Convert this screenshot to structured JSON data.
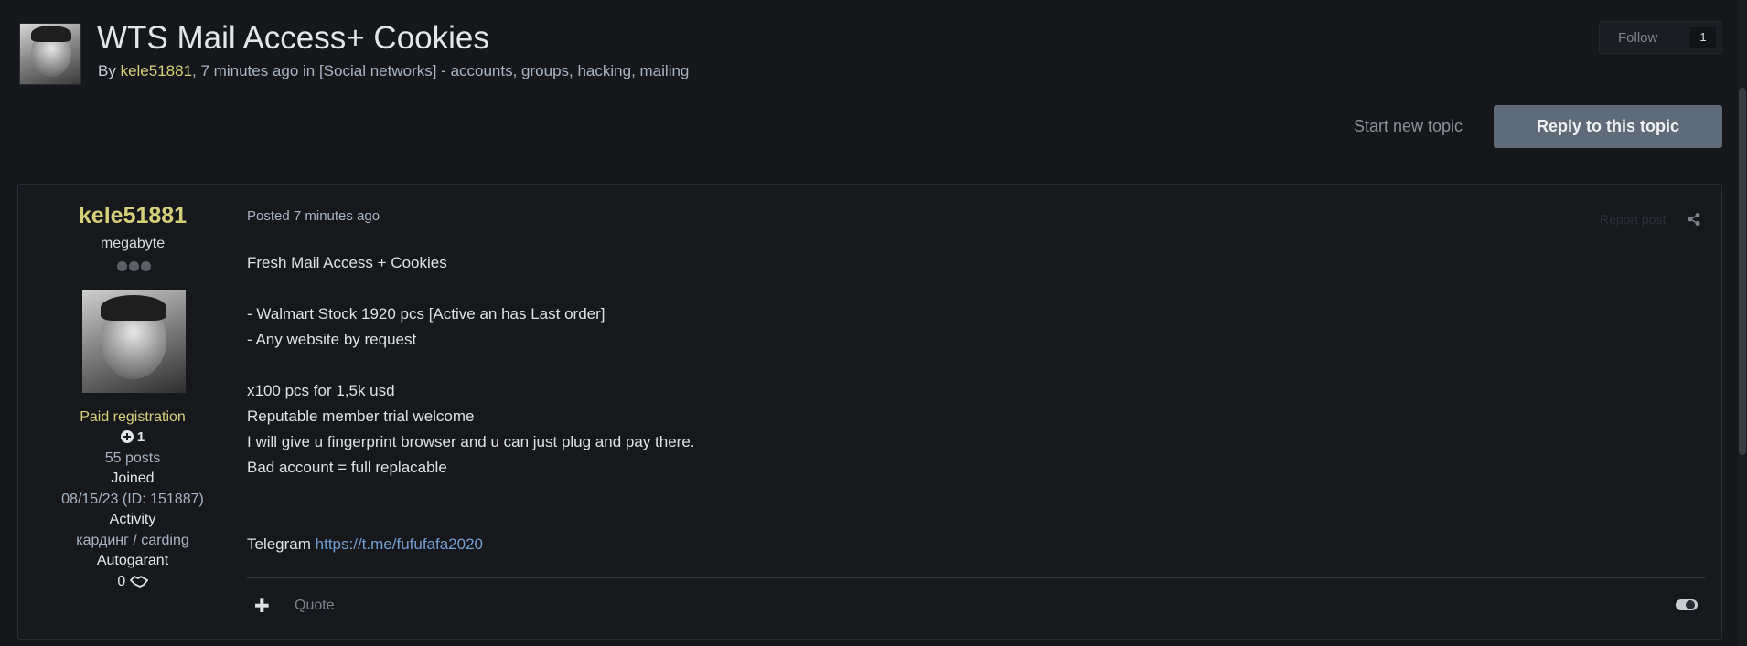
{
  "topic": {
    "title": "WTS Mail Access+ Cookies",
    "meta": {
      "by": "By",
      "author": "kele51881",
      "time_category": ", 7 minutes ago in [Social networks] - accounts, groups, hacking, mailing"
    },
    "follow": {
      "label": "Follow",
      "count": "1"
    },
    "start_new_topic": "Start new topic",
    "reply_button": "Reply to this topic"
  },
  "post": {
    "author": {
      "name": "kele51881",
      "title": "megabyte",
      "group": "Paid registration",
      "reputation": "1",
      "posts": "55 posts",
      "joined_label": "Joined",
      "joined_value": "08/15/23 (ID: 151887)",
      "activity_label": "Activity",
      "activity_value": "кардинг / carding",
      "autogarant_label": "Autogarant",
      "autogarant_value": "0"
    },
    "posted": "Posted 7 minutes ago",
    "report": "Report post",
    "body": [
      "Fresh Mail Access + Cookies",
      "",
      "- Walmart Stock 1920 pcs [Active an has Last order]",
      "- Any website by request",
      "",
      "x100 pcs for 1,5k usd",
      "Reputable member trial welcome",
      "I will give u fingerprint browser and u can just plug and pay there.",
      "Bad account = full replacable",
      "",
      ""
    ],
    "telegram_label": "Telegram",
    "telegram_link": "https://t.me/fufufafa2020",
    "actions": {
      "plus": "✚",
      "quote": "Quote"
    }
  },
  "colors": {
    "background": "#16171b",
    "author_accent": "#d6cf7a",
    "link": "#6f9fd0",
    "reply_button": "#5f6b78"
  },
  "icons": [
    "share-icon",
    "plus-circle-icon",
    "handshake-icon",
    "toggle-icon"
  ]
}
